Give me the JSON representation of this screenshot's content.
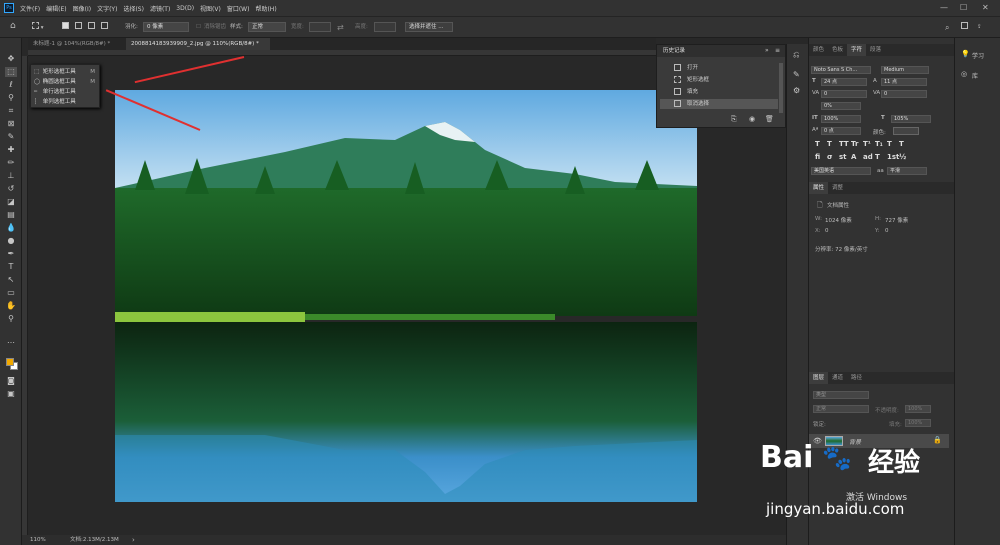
{
  "menubar": {
    "logo": "Ps",
    "items": [
      "文件(F)",
      "编辑(E)",
      "图像(I)",
      "文字(Y)",
      "选择(S)",
      "滤镜(T)",
      "3D(D)",
      "视图(V)",
      "窗口(W)",
      "帮助(H)"
    ],
    "window_buttons": [
      "—",
      "☐",
      "✕"
    ]
  },
  "options": {
    "feather_label": "羽化:",
    "feather_value": "0 像素",
    "antialias_label": "消除锯齿",
    "style_label": "样式:",
    "style_value": "正常",
    "width_label": "宽度:",
    "height_label": "高度:",
    "select_mask_button": "选择并遮住 ..."
  },
  "tabs": [
    {
      "label": "未标题-1 @ 104%(RGB/8#) *",
      "close": "×"
    },
    {
      "label": "2008814183939909_2.jpg @ 110%(RGB/8#) *",
      "close": "×"
    }
  ],
  "flyout": {
    "items": [
      {
        "icon": "⬚",
        "label": "矩形选框工具",
        "key": "M"
      },
      {
        "icon": "◯",
        "label": "椭圆选框工具",
        "key": "M"
      },
      {
        "icon": "┅",
        "label": "单行选框工具",
        "key": ""
      },
      {
        "icon": "┆",
        "label": "单列选框工具",
        "key": ""
      }
    ]
  },
  "history": {
    "title": "历史记录",
    "items": [
      "打开",
      "矩形选框",
      "填充",
      "取消选择"
    ],
    "selected_index": 3
  },
  "character": {
    "tabs": [
      "颜色",
      "色板",
      "字符",
      "段落"
    ],
    "active_tab": 2,
    "font": "Noto Sans S Ch...",
    "weight": "Medium",
    "size": "24 点",
    "leading": "11 点",
    "kerning": "0",
    "tracking": "0",
    "scale_label": "0%",
    "vscale": "100%",
    "hscale": "105%",
    "baseline": "0 点",
    "color_label": "颜色:",
    "language": "美国英语",
    "aa_label": "aa",
    "aa_value": "平滑",
    "style_buttons": [
      "T",
      "T",
      "TT",
      "Tr",
      "T¹",
      "T₁",
      "T",
      "T"
    ],
    "ot_buttons": [
      "fi",
      "σ",
      "st",
      "A",
      "ad",
      "T",
      "1st",
      "½"
    ]
  },
  "properties": {
    "tabs": [
      "属性",
      "调整"
    ],
    "active_tab": 0,
    "header": "文档属性",
    "w_label": "W:",
    "w_value": "1024 像素",
    "h_label": "H:",
    "h_value": "727 像素",
    "x_label": "X:",
    "x_value": "0",
    "y_label": "Y:",
    "y_value": "0",
    "resolution": "分辨率: 72 像素/英寸"
  },
  "layers": {
    "tabs": [
      "图层",
      "通道",
      "路径"
    ],
    "active_tab": 0,
    "kind_label": "类型",
    "blend_mode": "正常",
    "opacity_label": "不透明度:",
    "opacity_value": "100%",
    "lock_label": "锁定:",
    "fill_label": "填充:",
    "fill_value": "100%",
    "layer_name": "背景"
  },
  "farright": {
    "learn": "学习",
    "library": "库"
  },
  "status": {
    "zoom": "110%",
    "doc": "文档:2.13M/2.13M"
  },
  "watermark": {
    "brand": "Bai",
    "brand2": "经验",
    "url": "jingyan.baidu.com",
    "activate": "激活 Windows"
  },
  "colors": {
    "foreground": "#f2a900",
    "background": "#ffffff",
    "accent": "#31a8ff",
    "arrow": "#e03030"
  }
}
